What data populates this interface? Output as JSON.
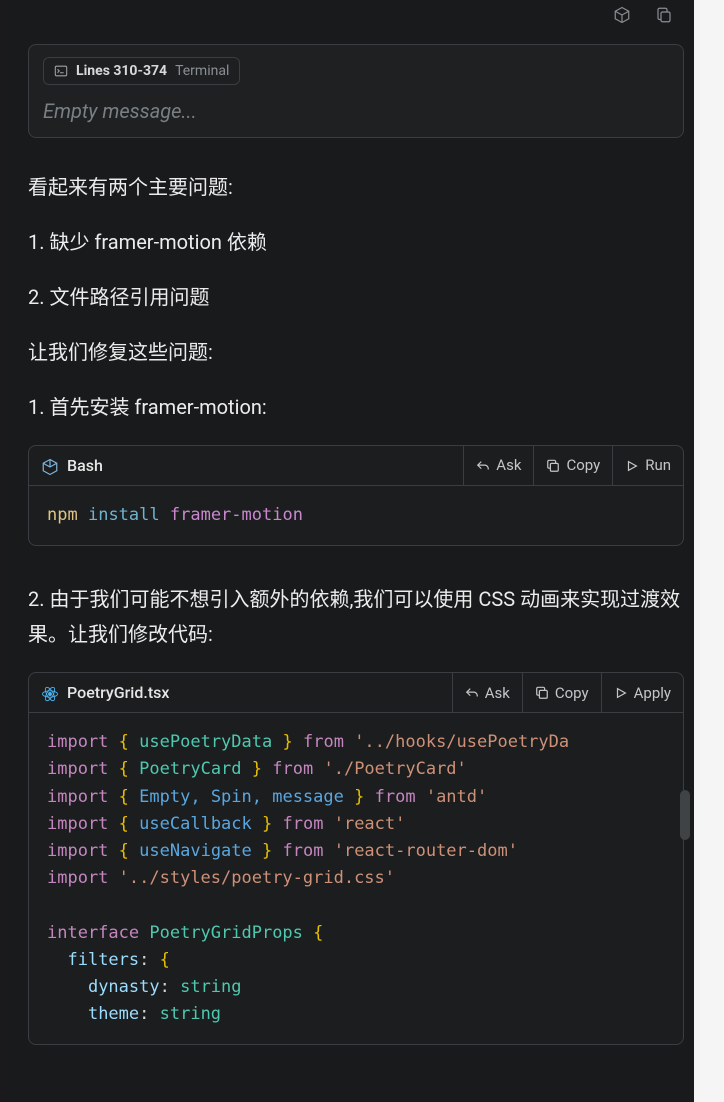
{
  "header_icons": [
    "cube-icon",
    "copy-icon"
  ],
  "context_chip": {
    "label": "Lines 310-374",
    "source": "Terminal"
  },
  "input_placeholder": "Empty message...",
  "response": {
    "p1": "看起来有两个主要问题:",
    "p2": "1. 缺少 framer-motion 依赖",
    "p3": "2. 文件路径引用问题",
    "p4": "让我们修复这些问题:",
    "p5": "1. 首先安装 framer-motion:",
    "p6": "2. 由于我们可能不想引入额外的依赖,我们可以使用 CSS 动画来实现过渡效果。让我们修改代码:"
  },
  "bash_block": {
    "title": "Bash",
    "actions": {
      "ask": "Ask",
      "copy": "Copy",
      "run": "Run"
    },
    "cmd1_word1": "npm",
    "cmd1_word2": "install",
    "cmd1_word3": "framer-motion"
  },
  "tsx_block": {
    "title": "PoetryGrid.tsx",
    "actions": {
      "ask": "Ask",
      "copy": "Copy",
      "apply": "Apply"
    },
    "lines": {
      "l1": {
        "kw": "import",
        "br1": "{",
        "id": "usePoetryData",
        "br2": "}",
        "from": "from",
        "str": "'../hooks/usePoetryDa"
      },
      "l2": {
        "kw": "import",
        "br1": "{",
        "id": "PoetryCard",
        "br2": "}",
        "from": "from",
        "str": "'./PoetryCard'"
      },
      "l3": {
        "kw": "import",
        "br1": "{",
        "id": "Empty, Spin, message",
        "br2": "}",
        "from": "from",
        "str": "'antd'"
      },
      "l4": {
        "kw": "import",
        "br1": "{",
        "id": "useCallback",
        "br2": "}",
        "from": "from",
        "str": "'react'"
      },
      "l5": {
        "kw": "import",
        "br1": "{",
        "id": "useNavigate",
        "br2": "}",
        "from": "from",
        "str": "'react-router-dom'"
      },
      "l6": {
        "kw": "import",
        "str": "'../styles/poetry-grid.css'"
      },
      "l7": "",
      "l8": {
        "kw": "interface",
        "id": "PoetryGridProps",
        "br": "{"
      },
      "l9": {
        "prop": "filters",
        "colon": ": ",
        "br": "{"
      },
      "l10": {
        "prop": "dynasty",
        "colon": ": ",
        "type": "string"
      },
      "l11": {
        "prop": "theme",
        "colon": ": ",
        "type": "string"
      }
    }
  }
}
